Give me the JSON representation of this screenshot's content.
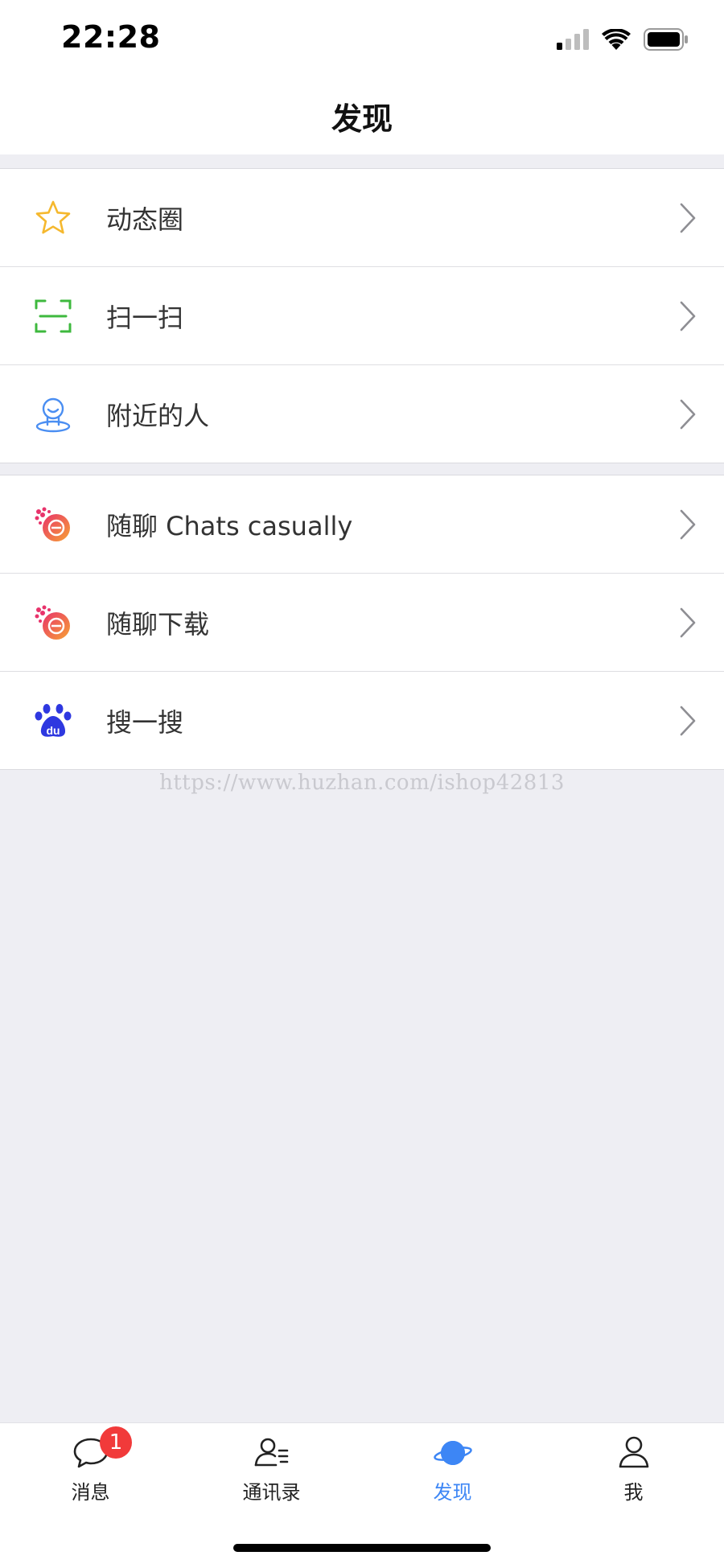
{
  "status_bar": {
    "time": "22:28"
  },
  "header": {
    "title": "发现"
  },
  "groups": [
    {
      "items": [
        {
          "label": "动态圈",
          "icon": "star-icon",
          "color": "#F5B82E"
        },
        {
          "label": "扫一扫",
          "icon": "scan-icon",
          "color": "#3EB93E"
        },
        {
          "label": "附近的人",
          "icon": "nearby-person-icon",
          "color": "#4A8EF2"
        }
      ]
    },
    {
      "items": [
        {
          "label": "随聊 Chats casually",
          "icon": "chats-casually-logo-icon",
          "color": "#E85C7A"
        },
        {
          "label": "随聊下载",
          "icon": "chats-casually-logo-icon",
          "color": "#E85C7A"
        },
        {
          "label": "搜一搜",
          "icon": "baidu-paw-icon",
          "color": "#2E38E0"
        }
      ]
    }
  ],
  "watermark": "https://www.huzhan.com/ishop42813",
  "tab_bar": {
    "tabs": [
      {
        "label": "消息",
        "icon": "chat-bubble-icon",
        "badge": "1",
        "active": false
      },
      {
        "label": "通讯录",
        "icon": "contacts-icon",
        "active": false
      },
      {
        "label": "发现",
        "icon": "planet-icon",
        "active": true
      },
      {
        "label": "我",
        "icon": "person-icon",
        "active": false
      }
    ],
    "active_color": "#3D86F5"
  }
}
